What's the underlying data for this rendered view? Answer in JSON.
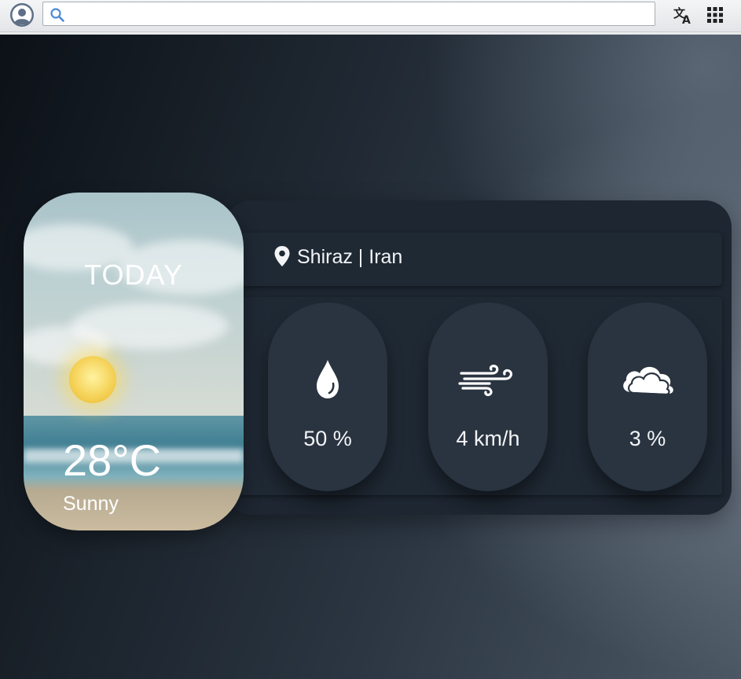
{
  "browser": {
    "search_value": "",
    "icons": [
      "user-avatar-icon",
      "search-icon",
      "translate-icon",
      "apps-grid-icon"
    ]
  },
  "weather": {
    "today_label": "TODAY",
    "temperature": "28°C",
    "condition": "Sunny",
    "location": "Shiraz | Iran",
    "stats": [
      {
        "icon": "humidity-drop-icon",
        "value": "50 %"
      },
      {
        "icon": "wind-icon",
        "value": "4 km/h"
      },
      {
        "icon": "cloud-icon",
        "value": "3 %"
      }
    ]
  },
  "colors": {
    "panel": "#1d2631",
    "pill": "#2a3440",
    "text": "#f2f4f6"
  }
}
